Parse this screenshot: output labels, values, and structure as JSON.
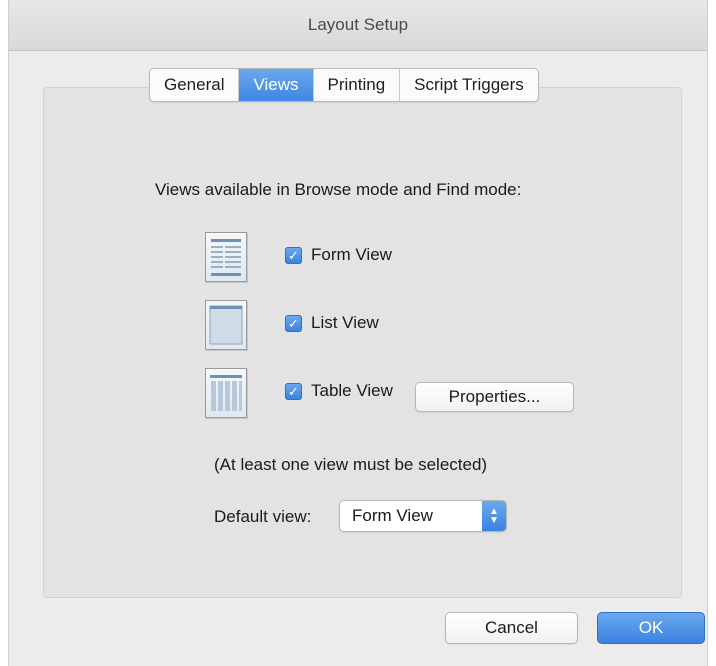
{
  "window": {
    "title": "Layout Setup"
  },
  "tabs": [
    {
      "label": "General",
      "active": false
    },
    {
      "label": "Views",
      "active": true
    },
    {
      "label": "Printing",
      "active": false
    },
    {
      "label": "Script Triggers",
      "active": false
    }
  ],
  "views": {
    "heading": "Views available in Browse mode and Find mode:",
    "items": [
      {
        "label": "Form View",
        "checked": true,
        "icon": "form-view-icon"
      },
      {
        "label": "List View",
        "checked": true,
        "icon": "list-view-icon"
      },
      {
        "label": "Table View",
        "checked": true,
        "icon": "table-view-icon"
      }
    ],
    "properties_button": "Properties...",
    "note": "(At least one view must be selected)",
    "default_view_label": "Default view:",
    "default_view_value": "Form View"
  },
  "buttons": {
    "cancel": "Cancel",
    "ok": "OK"
  },
  "colors": {
    "accent": "#3f86e3",
    "panel": "#e3e3e3",
    "window": "#ececec"
  }
}
